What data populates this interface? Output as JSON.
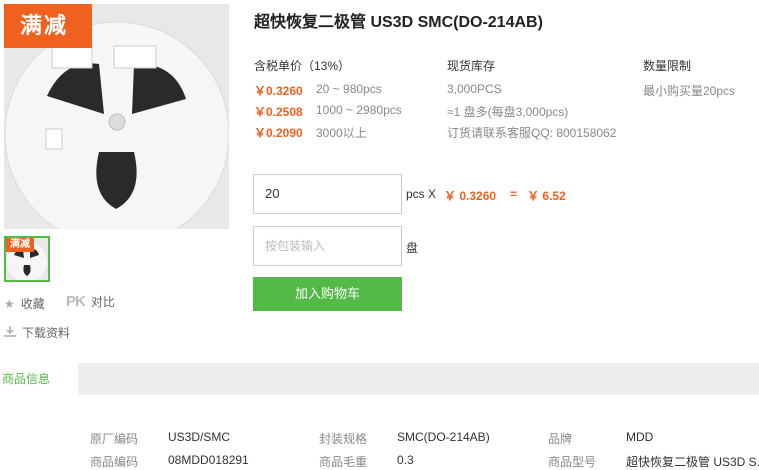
{
  "product": {
    "title": "超快恢复二极管 US3D SMC(DO-214AB)",
    "promo_badge": "满减",
    "thumb_badge": "满减"
  },
  "actions": {
    "favorite": "收藏",
    "compare_icon": "PK",
    "compare": "对比",
    "download": "下载资料"
  },
  "pricing": {
    "header": "含税单价（13%）",
    "tiers": [
      {
        "price": "￥0.3260",
        "range": "20 ~ 980pcs"
      },
      {
        "price": "￥0.2508",
        "range": "1000 ~ 2980pcs"
      },
      {
        "price": "￥0.2090",
        "range": "3000以上"
      }
    ]
  },
  "stock": {
    "header": "现货库存",
    "quantity": "3,000PCS",
    "reels": "≈1 盘多(每盘3,000pcs)",
    "contact": "订货请联系客服QQ: 800158062"
  },
  "limit": {
    "header": "数量限制",
    "min": "最小购买量20pcs"
  },
  "order": {
    "qty_value": "20",
    "unit": "pcs X",
    "unit_price": "￥ 0.3260",
    "equals": "=",
    "total": "￥ 6.52",
    "pack_placeholder": "按包装输入",
    "pack_unit": "盘",
    "add_to_cart": "加入购物车"
  },
  "tabs": {
    "info": "商品信息"
  },
  "specs": {
    "row1": [
      {
        "label": "原厂编码",
        "value": "US3D/SMC"
      },
      {
        "label": "封装规格",
        "value": "SMC(DO-214AB)"
      },
      {
        "label": "品牌",
        "value": "MDD"
      }
    ],
    "row2": [
      {
        "label": "商品编码",
        "value": "08MDD018291"
      },
      {
        "label": "商品毛重",
        "value": "0.3"
      },
      {
        "label": "商品型号",
        "value": "超快恢复二极管 US3D S..."
      }
    ]
  },
  "colors": {
    "accent_orange": "#f0601e",
    "accent_green": "#53b947"
  }
}
